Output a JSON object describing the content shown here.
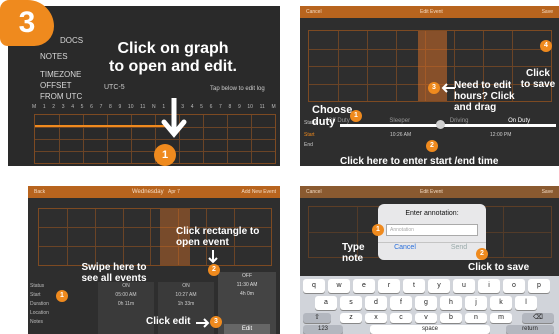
{
  "step_number": "3",
  "panel1": {
    "menu": [
      "DOCS",
      "NOTES"
    ],
    "timezone_label": "TIMEZONE",
    "offset_label": "OFFSET",
    "from_utc_label": "FROM UTC",
    "timezone_value": "UTC-5",
    "hint": "Tap below to edit log",
    "hours": [
      "M",
      "1",
      "2",
      "3",
      "4",
      "5",
      "6",
      "7",
      "8",
      "9",
      "10",
      "11",
      "N",
      "1",
      "2",
      "3",
      "4",
      "5",
      "6",
      "7",
      "8",
      "9",
      "10",
      "11",
      "M"
    ],
    "callout": "Click on graph to open and edit.",
    "badge": "1"
  },
  "panel2": {
    "topbar": {
      "left": "Cancel",
      "title": "Edit Event",
      "right": "Save"
    },
    "choose_duty": "Choose duty",
    "need_edit": "Need to edit hours? Click and drag",
    "click_save": "Click to save",
    "click_start_end": "Click here to enter start /end time",
    "duty_tabs": [
      "Off Duty",
      "Sleeper",
      "Driving",
      "On Duty"
    ],
    "status_label": "Status",
    "start_label": "Start",
    "end_label": "End",
    "times": [
      "10:26 AM",
      "12:00 PM"
    ],
    "badges": [
      "1",
      "2",
      "3",
      "4"
    ]
  },
  "panel3": {
    "topbar": {
      "left": "Back",
      "title": "Wednesday",
      "date": "Apr 7",
      "right": "Add New Event"
    },
    "click_rectangle": "Click rectangle to open event",
    "swipe": "Swipe here to see all events",
    "click_edit": "Click edit",
    "rows": [
      "Status",
      "Start",
      "Duration",
      "Location",
      "Notes"
    ],
    "cards": [
      {
        "status": "ON",
        "start": "05:00 AM",
        "duration": "0h 11m"
      },
      {
        "status": "ON",
        "start": "10:27 AM",
        "duration": "1h 33m"
      },
      {
        "status": "OFF",
        "start": "11:30 AM",
        "duration": "4h 0m"
      }
    ],
    "edit_label": "Edit",
    "badges": [
      "1",
      "2",
      "3"
    ]
  },
  "panel4": {
    "topbar": {
      "left": "Cancel",
      "title": "Edit Event",
      "right": "Save"
    },
    "dialog_title": "Enter annotation:",
    "input_placeholder": "Annotation",
    "cancel": "Cancel",
    "send": "Send",
    "type_note": "Type note",
    "click_to_save": "Click to save",
    "keyboard": {
      "row1": [
        "q",
        "w",
        "e",
        "r",
        "t",
        "y",
        "u",
        "i",
        "o",
        "p"
      ],
      "row2": [
        "a",
        "s",
        "d",
        "f",
        "g",
        "h",
        "j",
        "k",
        "l"
      ],
      "row3": [
        "z",
        "x",
        "c",
        "v",
        "b",
        "n",
        "m"
      ],
      "shift": "⇧",
      "delete": "⌫",
      "numbers": "123",
      "space": "space",
      "return": "return"
    },
    "badges": [
      "1",
      "2"
    ]
  }
}
